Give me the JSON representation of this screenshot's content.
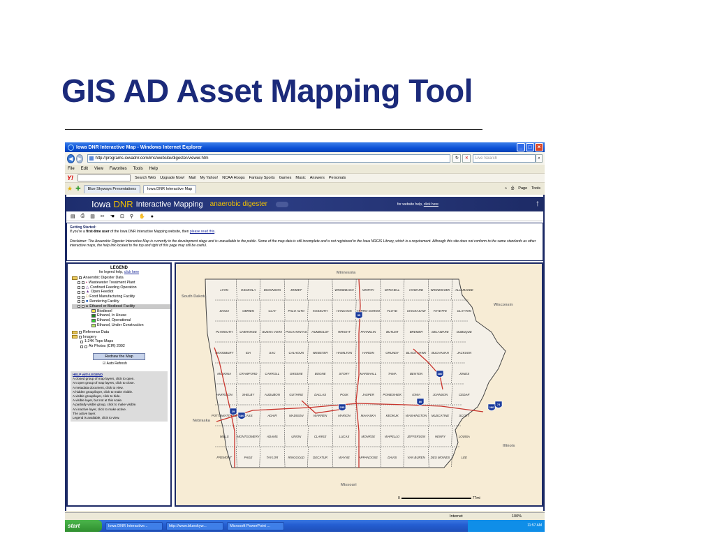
{
  "slide": {
    "title": "GIS AD Asset Mapping Tool"
  },
  "browser": {
    "window_title": "Iowa DNR Interactive Map - Windows Internet Explorer",
    "url": "http://programs.iowadnr.com/ims/website/digester/viewer.htm",
    "live_search_placeholder": "Live Search",
    "menu": [
      "File",
      "Edit",
      "View",
      "Favorites",
      "Tools",
      "Help"
    ],
    "yahoo_toolbar": [
      "Search Web",
      "Upgrade Now!",
      "Mail",
      "My Yahoo!",
      "NCAA Hoops",
      "Fantasy Sports",
      "Games",
      "Music",
      "Answers",
      "Personals"
    ],
    "tabs": [
      "Blue Skyways Presentations",
      "Iowa DNR Interactive Map"
    ],
    "right_tools": [
      "Page",
      "Tools"
    ]
  },
  "page": {
    "header": {
      "iowa": "Iowa",
      "dnr": "DNR",
      "interactive": "Interactive Mapping",
      "subtitle": "anaerobic digester",
      "help_text": "for website help,",
      "help_link": "click here"
    },
    "getting_started": {
      "title": "Getting Started:",
      "line1_a": "If you're a",
      "line1_b": "first-time user",
      "line1_c": "of the Iowa DNR Interactive Mapping website, then",
      "line1_link": "please read this",
      "disclaimer": "Disclaimer: The Anaerobic Digester Interactive Map is currently in the development stage and is unavailable to the public. Some of the map data is still incomplete and is not registered in the Iowa NRGIS Library, which is a requirement. Although this site does not conform to the same standards as other interactive maps, the help link located to the top and right of this page may still be useful."
    },
    "legend": {
      "title": "LEGEND",
      "help_text": "for legend help,",
      "help_link": "click here",
      "group": "Anaerobic Digester Data",
      "layers": [
        "Wastewater Treatment Plant",
        "Confined Feeding Operation",
        "Open Feedlot",
        "Food Manufacturing Facility",
        "Rendering Facility",
        "Ethanol or Biodiesel Facility"
      ],
      "ethanol_subs": [
        {
          "label": "Biodiesel",
          "color": "#f2e24a"
        },
        {
          "label": "Ethanol, In House",
          "color": "#1e8b1e"
        },
        {
          "label": "Ethanol, Operational",
          "color": "#33cc33"
        },
        {
          "label": "Ethanol, Under Construction",
          "color": "#b8ee6a"
        }
      ],
      "reference": "Reference Data",
      "imagery": "Imagery",
      "imagery_items": [
        "1:24K Topo Maps",
        "Air Photos (CIR) 2002"
      ],
      "redraw": "Redraw the Map",
      "auto_refresh": "Auto Refresh"
    },
    "help_legend": {
      "title": "HELP with LEGEND",
      "items": [
        "A closed group of map layers, click to open.",
        "An open group of map layers, click to close.",
        "A metadata document, click to view.",
        "A hidden group/layer, click to make visible.",
        "A visible group/layer, click to hide.",
        "A visible layer, but not at this scale.",
        "A partially visible group, click to make visible.",
        "An inactive layer, click to make active.",
        "The active layer.",
        "Legend is available, click to view."
      ]
    },
    "map": {
      "neighbors": [
        "Minnesota",
        "South Dakota",
        "Wisconsin",
        "Nebraska",
        "Illinois",
        "Missouri"
      ],
      "scale_start": "0",
      "scale_end": "77mi",
      "counties": [
        [
          "LYON",
          "OSCEOLA",
          "DICKINSON",
          "EMMET",
          "",
          "WINNEBAGO",
          "WORTH",
          "MITCHELL",
          "HOWARD",
          "WINNESHIEK",
          "ALLAMAKEE"
        ],
        [
          "SIOUX",
          "OBRIEN",
          "CLAY",
          "PALO ALTO",
          "KOSSUTH",
          "HANCOCK",
          "CERRO GORDO",
          "FLOYD",
          "CHICKASAW",
          "FAYETTE",
          "CLAYTON"
        ],
        [
          "PLYMOUTH",
          "CHEROKEE",
          "BUENA VISTA",
          "POCAHONTAS",
          "HUMBOLDT",
          "WRIGHT",
          "FRANKLIN",
          "BUTLER",
          "BREMER",
          "DELAWARE",
          "DUBUQUE"
        ],
        [
          "WOODBURY",
          "IDA",
          "SAC",
          "CALHOUN",
          "WEBSTER",
          "HAMILTON",
          "HARDIN",
          "GRUNDY",
          "BLACK HAWK",
          "BUCHANAN",
          "JACKSON"
        ],
        [
          "MONONA",
          "CRAWFORD",
          "CARROLL",
          "GREENE",
          "BOONE",
          "STORY",
          "MARSHALL",
          "TAMA",
          "BENTON",
          "LINN",
          "JONES"
        ],
        [
          "HARRISON",
          "SHELBY",
          "AUDUBON",
          "GUTHRIE",
          "DALLAS",
          "POLK",
          "JASPER",
          "POWESHIEK",
          "IOWA",
          "JOHNSON",
          "CEDAR"
        ],
        [
          "POTTAWATTAMIE",
          "CASS",
          "ADAIR",
          "MADISON",
          "WARREN",
          "MARION",
          "MAHASKA",
          "KEOKUK",
          "WASHINGTON",
          "MUSCATINE",
          "SCOTT"
        ],
        [
          "MILLS",
          "MONTGOMERY",
          "ADAMS",
          "UNION",
          "CLARKE",
          "LUCAS",
          "MONROE",
          "WAPELLO",
          "JEFFERSON",
          "HENRY",
          "LOUISA"
        ],
        [
          "FREMONT",
          "PAGE",
          "TAYLOR",
          "RINGGOLD",
          "DECATUR",
          "WAYNE",
          "APPANOOSE",
          "DAVIS",
          "VAN BUREN",
          "DES MOINES",
          "LEE"
        ]
      ],
      "interstates": [
        "35",
        "80",
        "29",
        "380",
        "235",
        "680",
        "280",
        "74"
      ]
    }
  },
  "status": {
    "zone": "Internet",
    "zoom": "100%"
  },
  "taskbar": {
    "start": "start",
    "tasks": [
      "Iowa DNR Interactive...",
      "http://www.blueskyw...",
      "Microsoft PowerPoint ..."
    ],
    "clock": "11:57 AM"
  }
}
